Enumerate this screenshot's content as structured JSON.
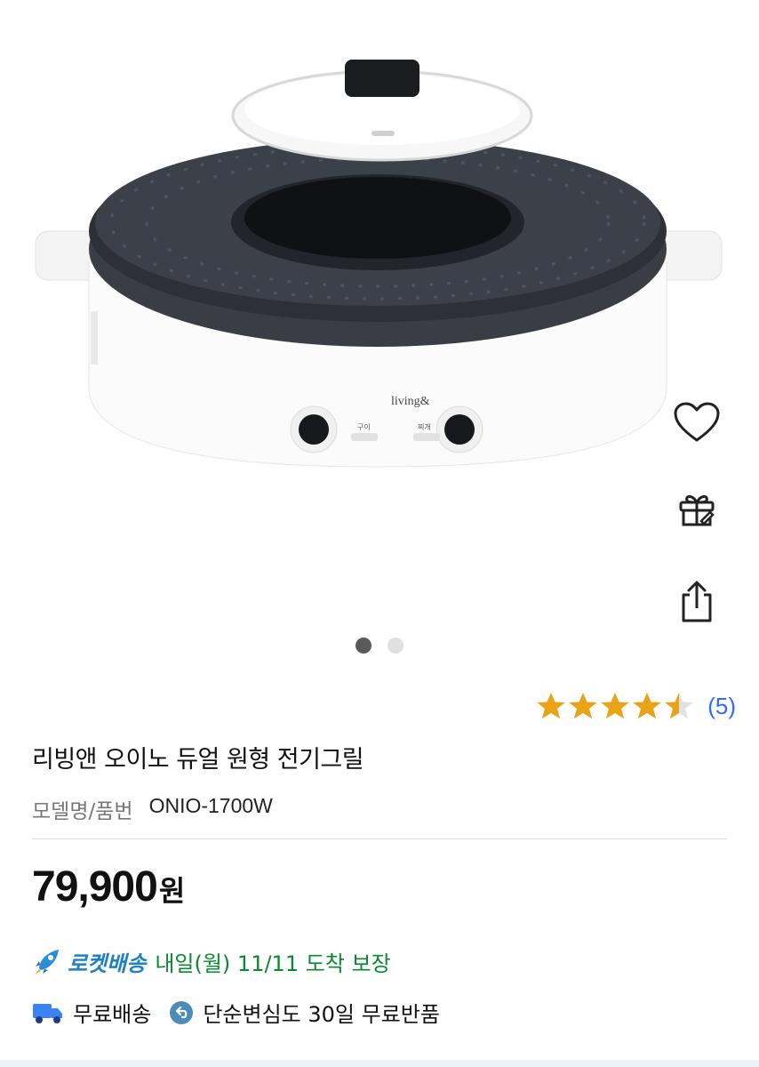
{
  "product": {
    "title": "리빙앤 오이노 듀얼 원형 전기그릴",
    "model_label": "모델명/품번",
    "model_value": "ONIO-1700W",
    "rating": 4.5,
    "review_count": "(5)",
    "image_brand": "living&",
    "knob_left": "구이",
    "knob_right": "찌개"
  },
  "gallery": {
    "current_page": 1,
    "total_pages": 2
  },
  "actions": {
    "favorite_icon": "heart-icon",
    "gift_icon": "gift-icon",
    "share_icon": "share-icon"
  },
  "price": {
    "amount": "79,900",
    "unit": "원"
  },
  "delivery": {
    "rocket_label": "로켓배송",
    "eta": "내일(월) 11/11 도착 보장",
    "free_shipping": "무료배송",
    "return_policy": "단순변심도 30일 무료반품"
  },
  "colors": {
    "rocket_blue": "#1f80c4",
    "eta_green": "#0a8a2e",
    "review_blue": "#346aff",
    "star_gold": "#e8a317"
  }
}
